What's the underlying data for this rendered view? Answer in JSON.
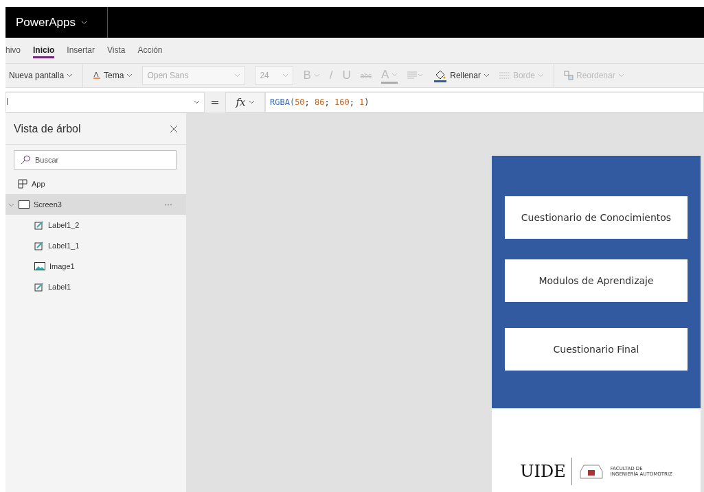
{
  "app_bar": {
    "title": "PowerApps"
  },
  "menu_tabs": [
    {
      "label": "hivo",
      "selected": false
    },
    {
      "label": "Inicio",
      "selected": true
    },
    {
      "label": "Insertar",
      "selected": false
    },
    {
      "label": "Vista",
      "selected": false
    },
    {
      "label": "Acción",
      "selected": false
    }
  ],
  "toolbar": [
    {
      "kind": "menu",
      "label": "Nueva pantalla",
      "disabled": false
    },
    {
      "kind": "theme",
      "label": "Tema",
      "disabled": false
    },
    {
      "kind": "select",
      "value": "Open Sans",
      "disabled": true
    },
    {
      "kind": "size",
      "value": "24",
      "disabled": true
    },
    {
      "kind": "glyph",
      "label": "B",
      "disabled": true,
      "chevron": true
    },
    {
      "kind": "glyph",
      "label": "/",
      "disabled": true,
      "chevron": false
    },
    {
      "kind": "glyph",
      "label": "U",
      "disabled": true,
      "chevron": false
    },
    {
      "kind": "glyph",
      "label": "abc",
      "disabled": true,
      "chevron": false
    },
    {
      "kind": "fontcolor",
      "label": "A",
      "disabled": true
    },
    {
      "kind": "align",
      "disabled": true
    },
    {
      "kind": "fill",
      "label": "Rellenar",
      "disabled": false
    },
    {
      "kind": "border",
      "label": "Borde",
      "disabled": true
    },
    {
      "kind": "reorder",
      "label": "Reordenar",
      "disabled": true
    }
  ],
  "formula_bar": {
    "property": "l",
    "equals": "=",
    "fx": "fx",
    "tokens": [
      {
        "text": "RGBA(",
        "kind": "func"
      },
      {
        "text": "50",
        "kind": "num"
      },
      {
        "text": "; ",
        "kind": "punct"
      },
      {
        "text": "86",
        "kind": "num"
      },
      {
        "text": "; ",
        "kind": "punct"
      },
      {
        "text": "160",
        "kind": "num"
      },
      {
        "text": "; ",
        "kind": "punct"
      },
      {
        "text": "1",
        "kind": "num"
      },
      {
        "text": ")",
        "kind": "punct"
      }
    ]
  },
  "tree_view": {
    "title": "Vista de árbol",
    "search": {
      "placeholder": "Buscar"
    },
    "items": [
      {
        "label": "App",
        "kind": "app",
        "selected": false
      },
      {
        "label": "Screen3",
        "kind": "screen",
        "selected": true,
        "expanded": true,
        "more": "···",
        "children": [
          {
            "label": "Label1_2",
            "kind": "label",
            "selected": false
          },
          {
            "label": "Label1_1",
            "kind": "label",
            "selected": false
          },
          {
            "label": "Image1",
            "kind": "image",
            "selected": false
          },
          {
            "label": "Label1",
            "kind": "label",
            "selected": false
          }
        ]
      }
    ]
  },
  "app_screen": {
    "buttons": [
      "Cuestionario de Conocimientos",
      "Modulos de Aprendizaje",
      "Cuestionario Final"
    ],
    "logo": {
      "name": "UIDE",
      "faculty_line1": "FACULTAD DE",
      "faculty_line2": "INGENIERÍA AUTOMOTRIZ"
    }
  }
}
